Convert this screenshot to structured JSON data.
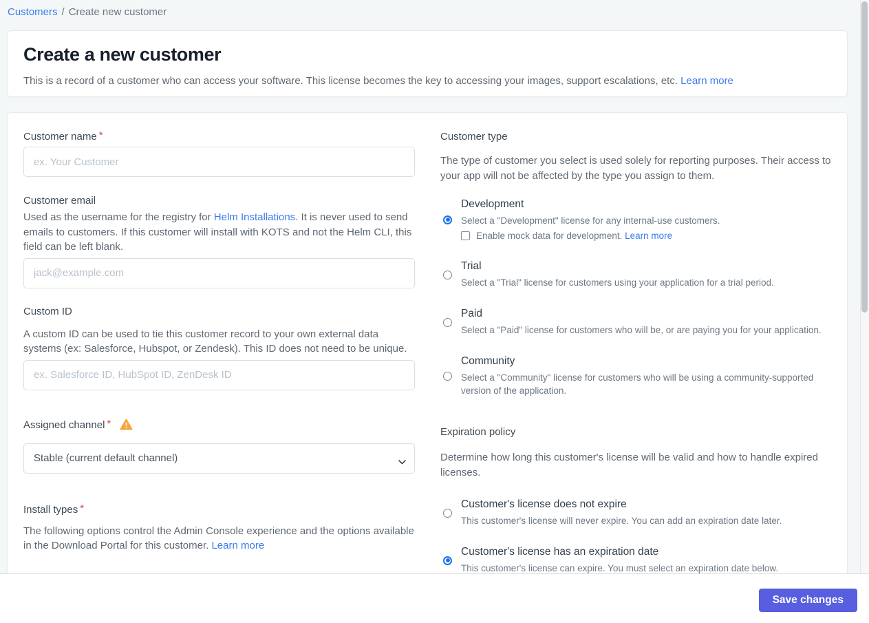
{
  "breadcrumb": {
    "link_label": "Customers",
    "separator": "/",
    "current": "Create new customer"
  },
  "header": {
    "title": "Create a new customer",
    "description": "This is a record of a customer who can access your software. This license becomes the key to accessing your images, support escalations, etc. ",
    "learn_more_label": "Learn more"
  },
  "form": {
    "customer_name": {
      "label": "Customer name",
      "required_marker": "*",
      "value": "",
      "placeholder": "ex. Your Customer"
    },
    "customer_email": {
      "label": "Customer email",
      "description_prefix": "Used as the username for the registry for ",
      "link_label": "Helm Installations",
      "description_suffix": ". It is never used to send emails to customers. If this customer will install with KOTS and not the Helm CLI, this field can be left blank.",
      "value": "",
      "placeholder": "jack@example.com"
    },
    "custom_id": {
      "label": "Custom ID",
      "description": "A custom ID can be used to tie this customer record to your own external data systems (ex: Salesforce, Hubspot, or Zendesk). This ID does not need to be unique.",
      "value": "",
      "placeholder": "ex. Salesforce ID, HubSpot ID, ZenDesk ID"
    },
    "assigned_channel": {
      "label": "Assigned channel",
      "required_marker": "*",
      "selected_option": "Stable (current default channel)"
    },
    "install_types": {
      "label": "Install types",
      "required_marker": "*",
      "description": "The following options control the Admin Console experience and the options available in the Download Portal for this customer. ",
      "learn_more_label": "Learn more"
    }
  },
  "customer_type": {
    "heading": "Customer type",
    "description": "The type of customer you select is used solely for reporting purposes. Their access to your app will not be affected by the type you assign to them.",
    "options": [
      {
        "title": "Development",
        "description": "Select a \"Development\" license for any internal-use customers.",
        "selected": true,
        "checkbox": {
          "label": "Enable mock data for development. ",
          "learn_more_label": "Learn more",
          "checked": false
        }
      },
      {
        "title": "Trial",
        "description": "Select a \"Trial\" license for customers using your application for a trial period.",
        "selected": false
      },
      {
        "title": "Paid",
        "description": "Select a \"Paid\" license for customers who will be, or are paying you for your application.",
        "selected": false
      },
      {
        "title": "Community",
        "description": "Select a \"Community\" license for customers who will be using a community-supported version of the application.",
        "selected": false
      }
    ]
  },
  "expiration_policy": {
    "heading": "Expiration policy",
    "description": "Determine how long this customer's license will be valid and how to handle expired licenses.",
    "options": [
      {
        "title": "Customer's license does not expire",
        "description": "This customer's license will never expire. You can add an expiration date later.",
        "selected": false
      },
      {
        "title": "Customer's license has an expiration date",
        "description": "This customer's license can expire. You must select an expiration date below.",
        "selected": true
      }
    ]
  },
  "footer": {
    "save_label": "Save changes"
  },
  "colors": {
    "link_blue": "#3b7bea",
    "radio_selected_blue": "#1a74e8",
    "save_button_indigo": "#575ee0",
    "required_red": "#cf4a4a",
    "warning_amber": "#f7a53c",
    "page_background": "#f4f7f8"
  }
}
